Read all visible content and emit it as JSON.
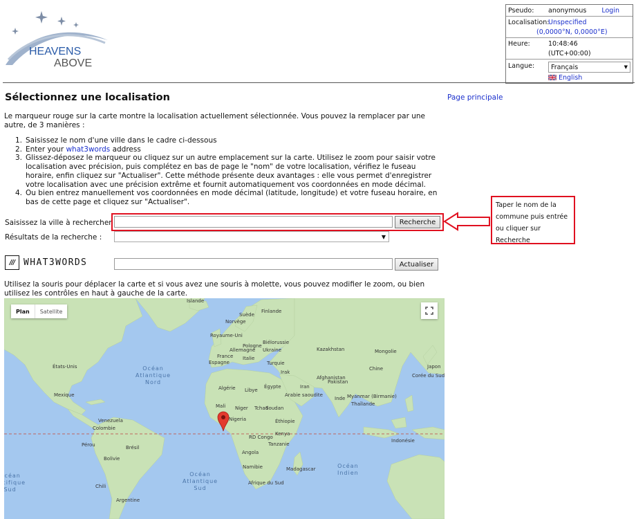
{
  "logo": {
    "line1": "HEAVENS",
    "line2": "ABOVE"
  },
  "user_panel": {
    "pseudo_label": "Pseudo:",
    "pseudo_value": "anonymous",
    "login_link": "Login",
    "location_label": "Localisation:",
    "location_value": "Unspecified",
    "location_coords": "(0,0000°N, 0,0000°E)",
    "time_label": "Heure:",
    "time_value": "10:48:46",
    "timezone": "(UTC+00:00)",
    "language_label": "Langue:",
    "language_selected": "Français",
    "english_link": "English"
  },
  "page": {
    "title": "Sélectionnez une localisation",
    "home_link": "Page principale",
    "intro": "Le marqueur rouge sur la carte montre la localisation actuellement sélectionnée. Vous pouvez la remplacer par une autre, de 3 manières :",
    "methods": [
      {
        "num": "1.",
        "text": "Saisissez le nom d'une ville dans le cadre ci-dessous"
      },
      {
        "num": "2.",
        "pre": "Enter your ",
        "link": "what3words",
        "post": " address"
      },
      {
        "num": "3.",
        "text": "Glissez-déposez le marqueur ou cliquez sur un autre emplacement sur la carte. Utilisez le zoom pour saisir votre localisation avec précision, puis complétez en bas de page le \"nom\" de votre localisation, vérifiez le fuseau horaire, enfin cliquez sur \"Actualiser\". Cette méthode présente deux avantages : elle vous permet d'enregistrer votre localisation avec une précision extrême et fournit automatiquement vos coordonnées en mode décimal."
      },
      {
        "num": "4.",
        "text": "Ou bien entrez manuellement vos coordonnées en mode décimal (latitude, longitude) et votre fuseau horaire, en bas de cette page et cliquez sur \"Actualiser\"."
      }
    ]
  },
  "search": {
    "label": "Saisissez la ville à rechercher :",
    "value": "",
    "button": "Recherche",
    "results_label": "Résultats de la recherche :",
    "results_selected": ""
  },
  "callout": {
    "text": "Taper le nom de la commune puis entrée ou cliquer sur Recherche"
  },
  "w3w": {
    "logo_mark": "///",
    "logo_text": "WHAT3WORDS",
    "value": "",
    "button": "Actualiser"
  },
  "map": {
    "help": "Utilisez la souris pour déplacer la carte et si vous avez une souris à molette, vous pouvez modifier le zoom, ou bien utilisez les contrôles en haut à gauche de la carte.",
    "type_plan": "Plan",
    "type_satellite": "Satellite",
    "ocean_labels": [
      {
        "id": "atl-n",
        "text": "Océan\nAtlantique\nNord"
      },
      {
        "id": "atl-s",
        "text": "Océan\nAtlantique\nSud"
      },
      {
        "id": "indian",
        "text": "Océan\nIndien"
      },
      {
        "id": "pac-s",
        "text": "Océan\nPacifique\nSud"
      }
    ],
    "place_labels": [
      "Islande",
      "Suède",
      "Finlande",
      "Norvège",
      "Royaume-Uni",
      "Biélorussie",
      "Pologne",
      "Allemagne",
      "Ukraine",
      "Kazakhstan",
      "France",
      "Italie",
      "Mongolie",
      "Espagne",
      "Turquie",
      "Chine",
      "Japon",
      "Corée du Sud",
      "États-Unis",
      "Irak",
      "Afghanistan",
      "Iran",
      "Algérie",
      "Libye",
      "Égypte",
      "Pakistan",
      "Mexique",
      "Arabie saoudite",
      "Inde",
      "Myanmar (Birmanie)",
      "Thaïlande",
      "Mali",
      "Niger",
      "Tchad",
      "Soudan",
      "Venezuela",
      "Nigeria",
      "Éthiopie",
      "Colombie",
      "Kenya",
      "RD Congo",
      "Tanzanie",
      "Indonésie",
      "Pérou",
      "Brésil",
      "Angola",
      "Bolivie",
      "Namibie",
      "Madagascar",
      "Afrique du Sud",
      "Chili",
      "Argentine"
    ]
  }
}
